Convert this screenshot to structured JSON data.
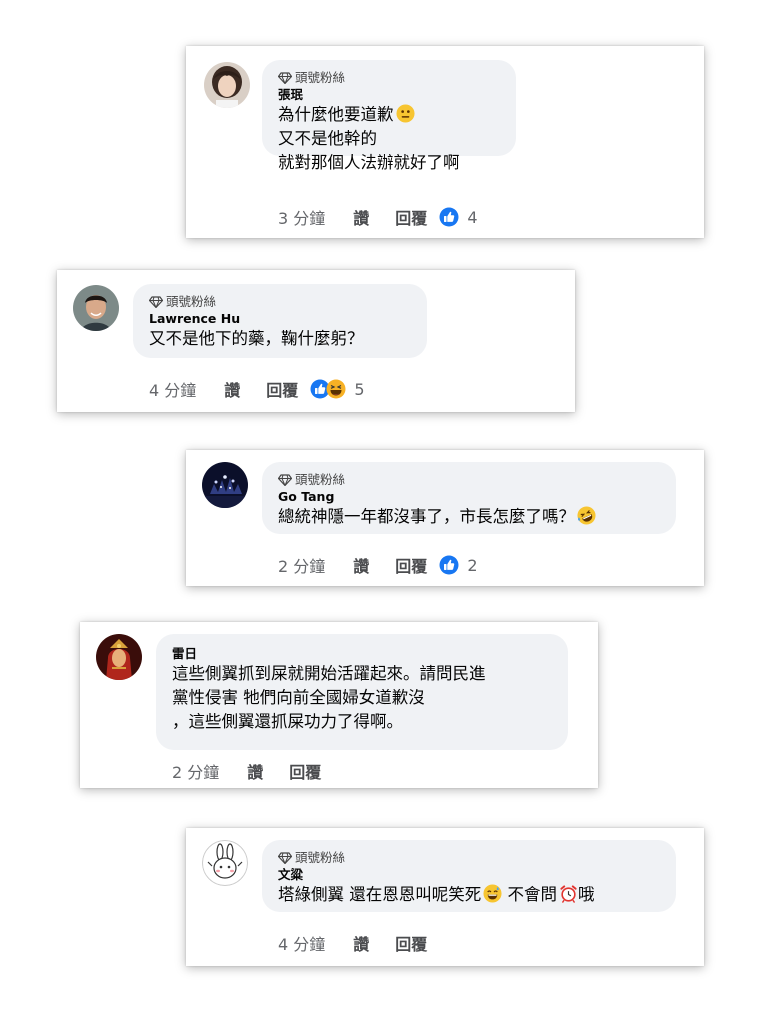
{
  "comments": [
    {
      "badge": "頭號粉絲",
      "author": "張珉",
      "lines": [
        "為什麼他要道歉",
        "又不是他幹的",
        "就對那個人法辦就好了啊"
      ],
      "time": "3 分鐘",
      "like": "讚",
      "reply": "回覆",
      "reaction_count": "4",
      "reactions": [
        "like"
      ]
    },
    {
      "badge": "頭號粉絲",
      "author": "Lawrence Hu",
      "lines": [
        "又不是他下的藥，鞠什麼躬？"
      ],
      "time": "4 分鐘",
      "like": "讚",
      "reply": "回覆",
      "reaction_count": "5",
      "reactions": [
        "like",
        "haha"
      ]
    },
    {
      "badge": "頭號粉絲",
      "author": "Go Tang",
      "lines": [
        "總統神隱一年都沒事了，市長怎麼了嗎？"
      ],
      "time": "2 分鐘",
      "like": "讚",
      "reply": "回覆",
      "reaction_count": "2",
      "reactions": [
        "like"
      ]
    },
    {
      "author": "雷日",
      "lines": [
        "這些側翼抓到屎就開始活躍起來。請問民進",
        "黨性侵害 牠們向前全國婦女道歉沒",
        "，這些側翼還抓屎功力了得啊。"
      ],
      "time": "2 分鐘",
      "like": "讚",
      "reply": "回覆"
    },
    {
      "badge": "頭號粉絲",
      "author": "文粱",
      "lines": [
        "塔綠側翼 還在恩恩叫呢笑死",
        " 不會問",
        "哦"
      ],
      "time": "4 分鐘",
      "like": "讚",
      "reply": "回覆"
    }
  ],
  "colors": {
    "bubble": "#f0f2f5",
    "like_blue": "#1877f2",
    "meta_gray": "#65676b"
  },
  "icons": [
    "top-fan-diamond-icon",
    "neutral-face-emoji",
    "rolling-laughing-emoji",
    "grinning-sweat-emoji",
    "alarm-clock-emoji",
    "like-reaction-icon",
    "haha-reaction-icon"
  ]
}
